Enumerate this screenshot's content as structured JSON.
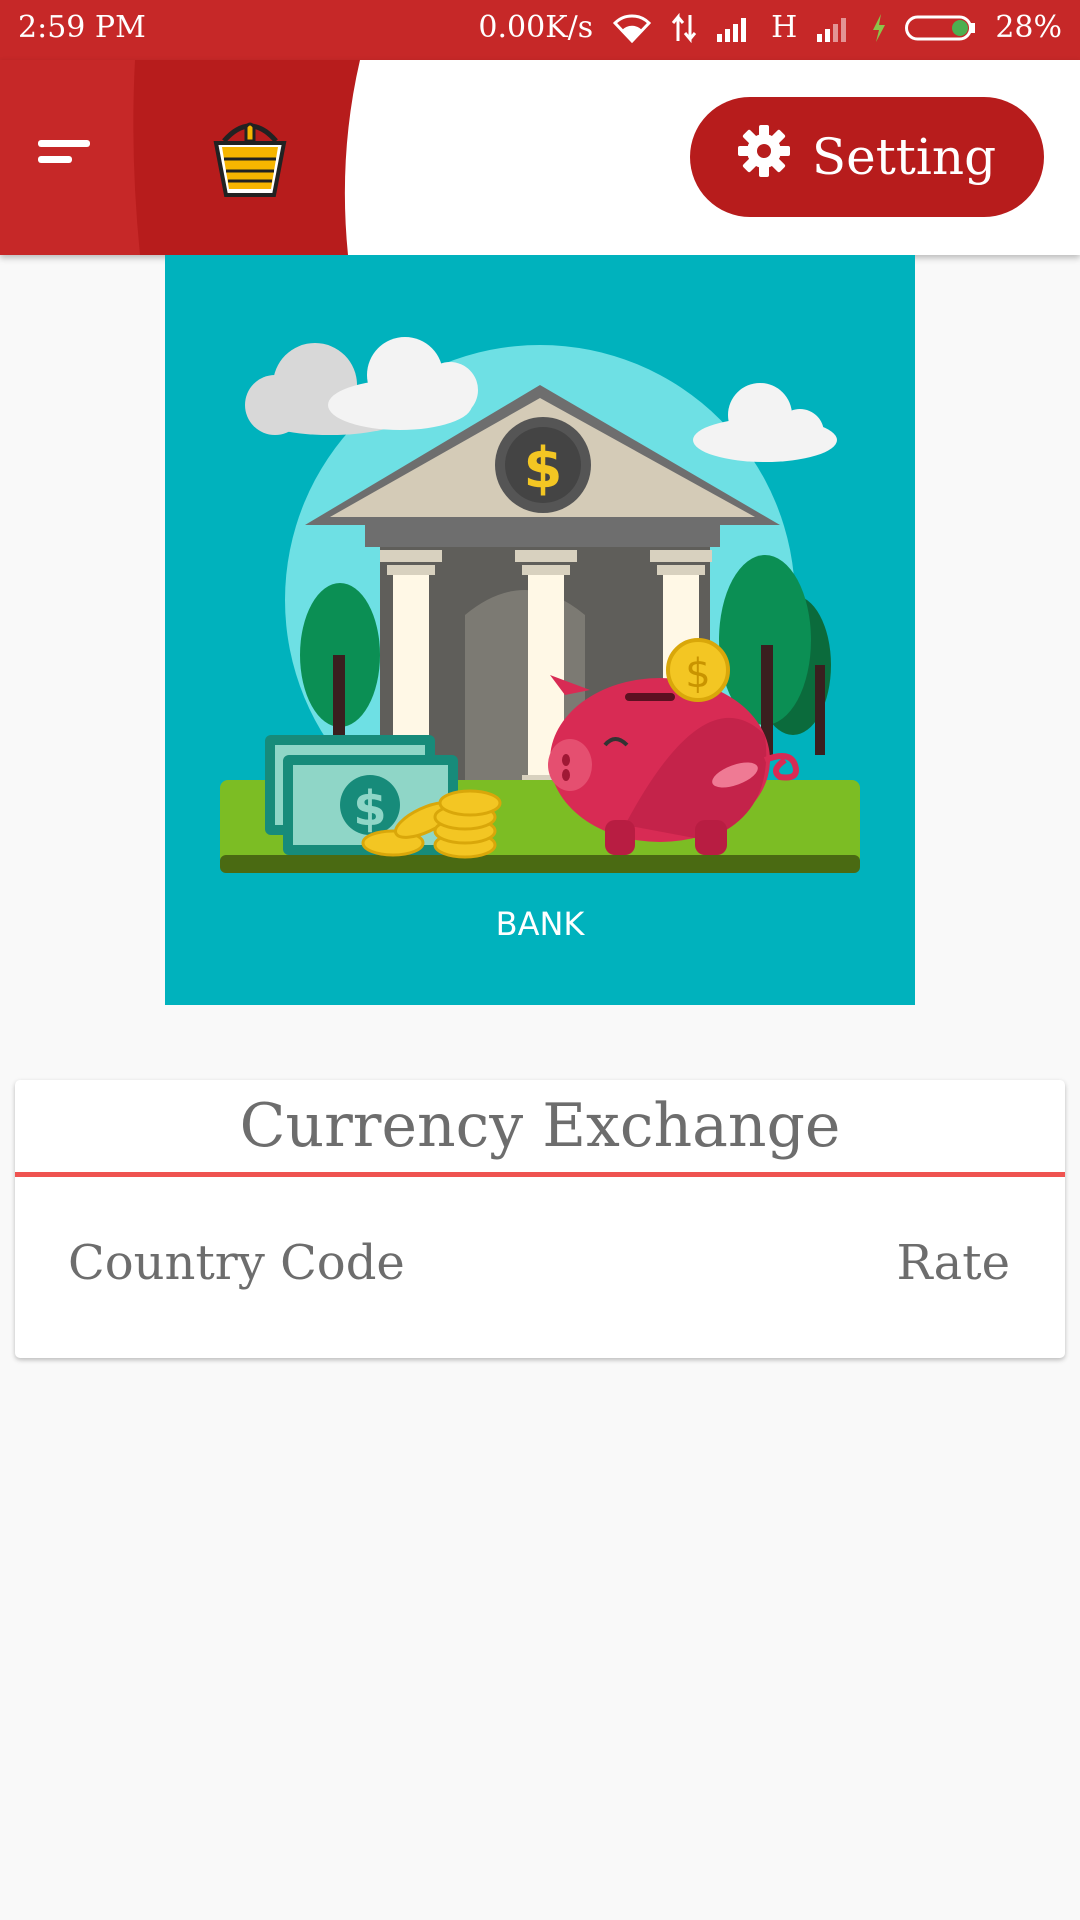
{
  "status_bar": {
    "time": "2:59 PM",
    "net_speed": "0.00K/s",
    "network_type": "H",
    "battery": "28%"
  },
  "app_bar": {
    "setting_label": "Setting",
    "colors": {
      "primary": "#c62828",
      "dark": "#b71c1c"
    }
  },
  "illustration": {
    "caption": "BANK"
  },
  "card": {
    "title": "Currency Exchange",
    "columns": {
      "left": "Country Code",
      "right": "Rate"
    },
    "accent": "#ef5350"
  }
}
